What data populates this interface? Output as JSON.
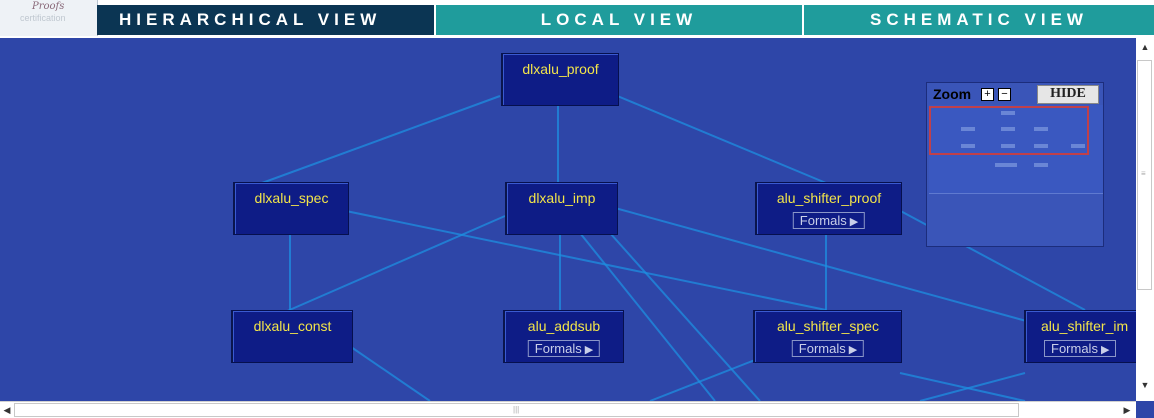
{
  "logo": {
    "line1": "Proofs",
    "line2": "certification"
  },
  "tabs": [
    {
      "label": "HIERARCHICAL VIEW"
    },
    {
      "label": "LOCAL VIEW"
    },
    {
      "label": "SCHEMATIC VIEW"
    }
  ],
  "nodes": [
    {
      "name": "dlxalu_proof",
      "formals": false
    },
    {
      "name": "dlxalu_spec",
      "formals": false
    },
    {
      "name": "dlxalu_imp",
      "formals": false
    },
    {
      "name": "alu_shifter_proof",
      "formals": true
    },
    {
      "name": "dlxalu_const",
      "formals": false
    },
    {
      "name": "alu_addsub",
      "formals": true
    },
    {
      "name": "alu_shifter_spec",
      "formals": true
    },
    {
      "name": "alu_shifter_im",
      "formals": true
    }
  ],
  "formals_label": "Formals",
  "zoom": {
    "label": "Zoom",
    "plus": "+",
    "minus": "−",
    "hide_label": "HIDE"
  },
  "colors": {
    "canvas": "#2e46a8",
    "node": "#0e1c86",
    "node_text": "#f2e44a",
    "edge": "#1e8fe0",
    "active_tab": "#0b3553",
    "inactive_tab": "#1f9c9c"
  }
}
